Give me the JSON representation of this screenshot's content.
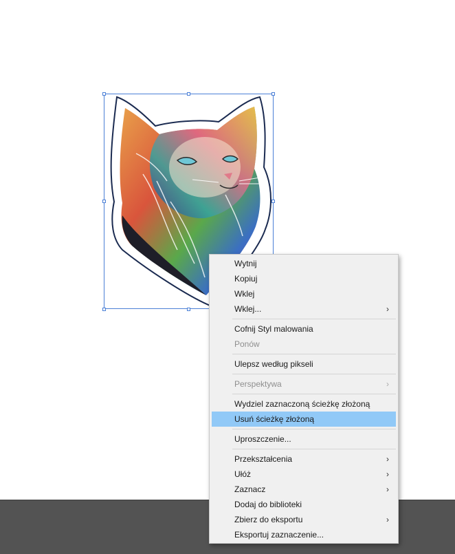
{
  "context_menu": {
    "items": [
      {
        "label": "Wytnij",
        "submenu": false,
        "disabled": false
      },
      {
        "label": "Kopiuj",
        "submenu": false,
        "disabled": false
      },
      {
        "label": "Wklej",
        "submenu": false,
        "disabled": false
      },
      {
        "label": "Wklej...",
        "submenu": true,
        "disabled": false
      },
      {
        "label": "Cofnij Styl malowania",
        "submenu": false,
        "disabled": false
      },
      {
        "label": "Ponów",
        "submenu": false,
        "disabled": true
      },
      {
        "label": "Ulepsz według pikseli",
        "submenu": false,
        "disabled": false
      },
      {
        "label": "Perspektywa",
        "submenu": true,
        "disabled": true
      },
      {
        "label": "Wydziel zaznaczoną ścieżkę złożoną",
        "submenu": false,
        "disabled": false
      },
      {
        "label": "Usuń ścieżkę złożoną",
        "submenu": false,
        "disabled": false,
        "highlighted": true
      },
      {
        "label": "Uproszczenie...",
        "submenu": false,
        "disabled": false
      },
      {
        "label": "Przekształcenia",
        "submenu": true,
        "disabled": false
      },
      {
        "label": "Ułóż",
        "submenu": true,
        "disabled": false
      },
      {
        "label": "Zaznacz",
        "submenu": true,
        "disabled": false
      },
      {
        "label": "Dodaj do biblioteki",
        "submenu": false,
        "disabled": false
      },
      {
        "label": "Zbierz do eksportu",
        "submenu": true,
        "disabled": false
      },
      {
        "label": "Eksportuj zaznaczenie...",
        "submenu": false,
        "disabled": false
      }
    ],
    "submenu_arrow": "›",
    "highlight_color": "#91c9f7"
  },
  "artwork": {
    "icon": "cat-sticker-image",
    "selection_color": "#4a7fd6"
  },
  "colors": {
    "canvas": "#ffffff",
    "pasteboard": "#535353",
    "menu_bg": "#f0f0f0"
  }
}
